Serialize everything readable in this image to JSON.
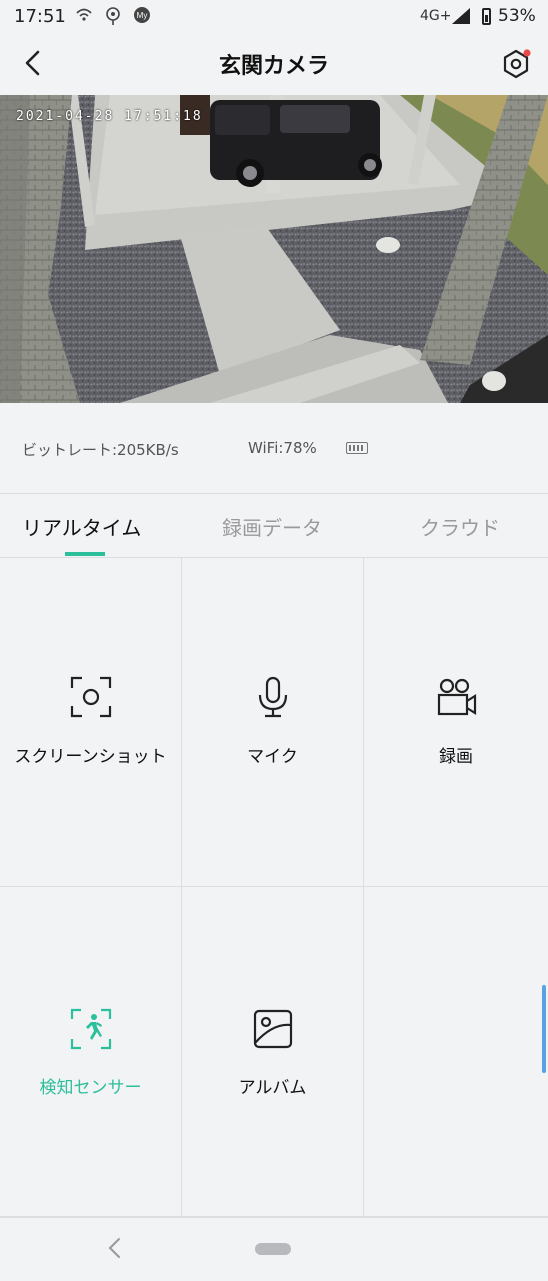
{
  "status_bar": {
    "time": "17:51",
    "network": "4G+",
    "battery_percent": "53%",
    "notification_icons": [
      "wifi-calling-icon",
      "location-pin-icon",
      "my-docomo-icon"
    ]
  },
  "header": {
    "title": "玄関カメラ",
    "back_icon": "chevron-left-icon",
    "settings_icon": "hexagon-gear-icon",
    "settings_badge_color": "#e84a4a"
  },
  "video": {
    "timestamp": "2021-04-28  17:51:18"
  },
  "info": {
    "bitrate": "ビットレート:205KB/s",
    "wifi": "WiFi:78%",
    "battery_icon": "battery-icon"
  },
  "tabs": [
    {
      "label": "リアルタイム",
      "active": true
    },
    {
      "label": "録画データ",
      "active": false
    },
    {
      "label": "クラウド",
      "active": false
    }
  ],
  "actions": [
    {
      "label": "スクリーンショット",
      "icon": "screenshot-icon"
    },
    {
      "label": "マイク",
      "icon": "microphone-icon"
    },
    {
      "label": "録画",
      "icon": "video-camera-icon"
    },
    {
      "label": "検知センサー",
      "icon": "motion-sensor-icon",
      "highlighted": true
    },
    {
      "label": "アルバム",
      "icon": "album-icon"
    }
  ],
  "colors": {
    "accent": "#2bbf9c",
    "background": "#f2f3f5",
    "scroll_indicator": "#5aa2e6"
  }
}
